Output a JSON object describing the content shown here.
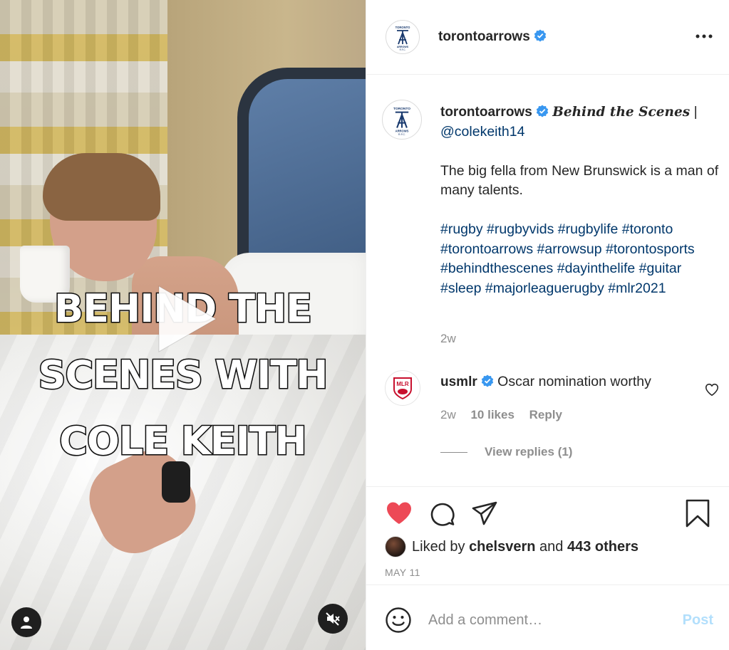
{
  "media": {
    "overlay_lines": [
      "BEHIND THE",
      "SCENES WITH",
      "COLE KEITH"
    ],
    "icons": {
      "play": "play-icon",
      "tag": "user-tag-icon",
      "mute": "muted-speaker-icon"
    }
  },
  "header": {
    "username": "torontoarrows",
    "verified": true,
    "more_icon": "more-options-icon",
    "logo_text": [
      "TORONTO",
      "ARROWS",
      "R.F.C."
    ]
  },
  "caption": {
    "username": "torontoarrows",
    "headline": "Behind the Scenes",
    "separator": " | ",
    "mention": "@colekeith14",
    "paragraph": "The big fella from New Brunswick is a man of many talents.",
    "hashtags": [
      "#rugby",
      "#rugbyvids",
      "#rugbylife",
      "#toronto",
      "#torontoarrows",
      "#arrowsup",
      "#torontosports",
      "#behindthescenes",
      "#dayinthelife",
      "#guitar",
      "#sleep",
      "#majorleaguerugby",
      "#mlr2021"
    ],
    "time": "2w"
  },
  "comment": {
    "username": "usmlr",
    "verified": true,
    "logo_text": "MLR",
    "text": "Oscar nomination worthy",
    "time": "2w",
    "likes": "10 likes",
    "reply_label": "Reply",
    "view_replies": "View replies (1)"
  },
  "actions": {
    "liked": true,
    "like_color": "#ed4956",
    "liked_by_prefix": "Liked by",
    "liked_by_user": "chelsvern",
    "liked_by_join": "and",
    "liked_by_others": "443 others",
    "date": "MAY 11"
  },
  "add_comment": {
    "placeholder": "Add a comment…",
    "post_label": "Post"
  },
  "colors": {
    "verified_blue": "#3897f0",
    "link_blue": "#00376b",
    "secondary_text": "#8e8e8e",
    "post_disabled": "#b2dffc"
  }
}
